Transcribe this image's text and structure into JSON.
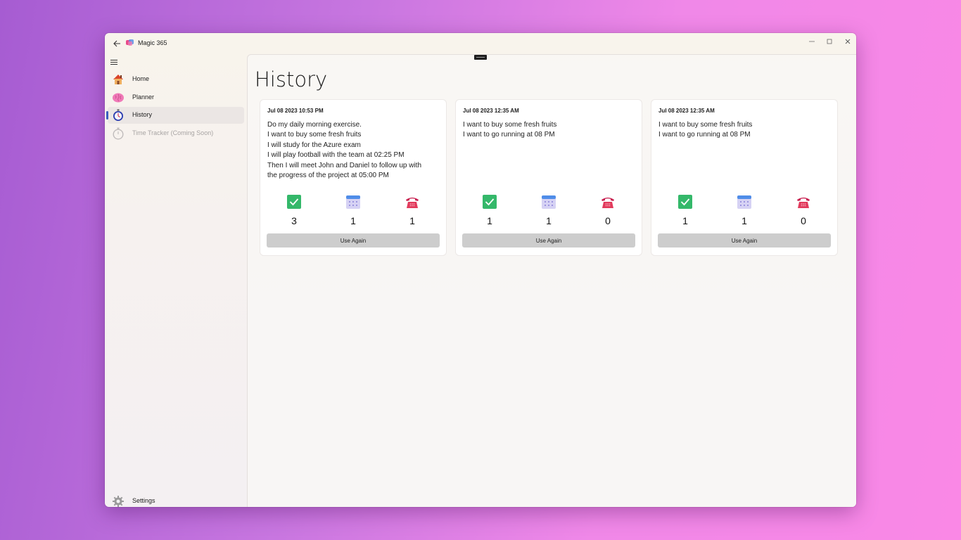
{
  "app": {
    "title": "Magic 365"
  },
  "sidebar": {
    "items": [
      {
        "label": "Home",
        "icon": "house-icon"
      },
      {
        "label": "Planner",
        "icon": "brain-icon"
      },
      {
        "label": "History",
        "icon": "stopwatch-icon",
        "active": true
      },
      {
        "label": "Time Tracker (Coming Soon)",
        "icon": "stopwatch-disabled-icon",
        "disabled": true
      }
    ],
    "settings": {
      "label": "Settings",
      "icon": "gear-icon"
    }
  },
  "page": {
    "title": "History"
  },
  "colors": {
    "accent": "#3a5fbf",
    "check": "#34b86a",
    "calendar": "#8a96e8",
    "phone": "#e23a5c"
  },
  "history": [
    {
      "date": "Jul 08 2023 10:53 PM",
      "lines": [
        "Do my daily morning exercise.",
        "I want to buy some fresh fruits",
        "I will study for the Azure exam",
        "I will play football with the team at 02:25 PM",
        "Then I will meet John and Daniel to follow up with",
        "the progress of the project at 05:00 PM"
      ],
      "tasks": "3",
      "events": "1",
      "calls": "1",
      "button": "Use Again"
    },
    {
      "date": "Jul 08 2023 12:35 AM",
      "lines": [
        "I want to buy some fresh fruits",
        "I want to go running at 08 PM"
      ],
      "tasks": "1",
      "events": "1",
      "calls": "0",
      "button": "Use Again"
    },
    {
      "date": "Jul 08 2023 12:35 AM",
      "lines": [
        "I want to buy some fresh fruits",
        "I want to go running at 08 PM"
      ],
      "tasks": "1",
      "events": "1",
      "calls": "0",
      "button": "Use Again"
    }
  ]
}
